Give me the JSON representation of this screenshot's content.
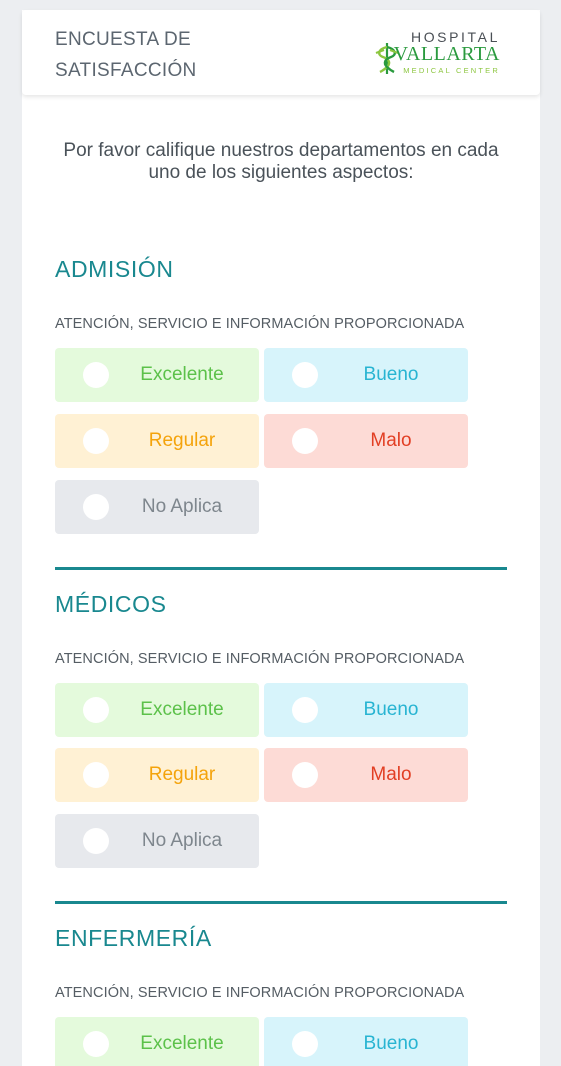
{
  "header": {
    "title_line1": "ENCUESTA DE",
    "title_line2": "SATISFACCIÓN",
    "logo": {
      "line1": "HOSPITAL",
      "line2": "VALLARTA",
      "line3": "MEDICAL CENTER"
    }
  },
  "intro": "Por favor califique nuestros departamentos en cada uno de los siguientes aspectos:",
  "sections": [
    {
      "title": "ADMISIÓN",
      "question": "ATENCIÓN, SERVICIO E INFORMACIÓN PROPORCIONADA",
      "options": [
        "Excelente",
        "Bueno",
        "Regular",
        "Malo",
        "No Aplica"
      ]
    },
    {
      "title": "MÉDICOS",
      "question": "ATENCIÓN, SERVICIO E INFORMACIÓN PROPORCIONADA",
      "options": [
        "Excelente",
        "Bueno",
        "Regular",
        "Malo",
        "No Aplica"
      ]
    },
    {
      "title": "ENFERMERÍA",
      "question": "ATENCIÓN, SERVICIO E INFORMACIÓN PROPORCIONADA",
      "options": [
        "Excelente",
        "Bueno"
      ]
    }
  ],
  "colors": {
    "accent": "#19888f",
    "excelente": "#5cc14a",
    "bueno": "#28b4d2",
    "regular": "#f4a30b",
    "malo": "#e23f24",
    "no_aplica": "#7e868d"
  },
  "icons": [
    "caduceus-logo-icon",
    "radio-unchecked-icon"
  ]
}
